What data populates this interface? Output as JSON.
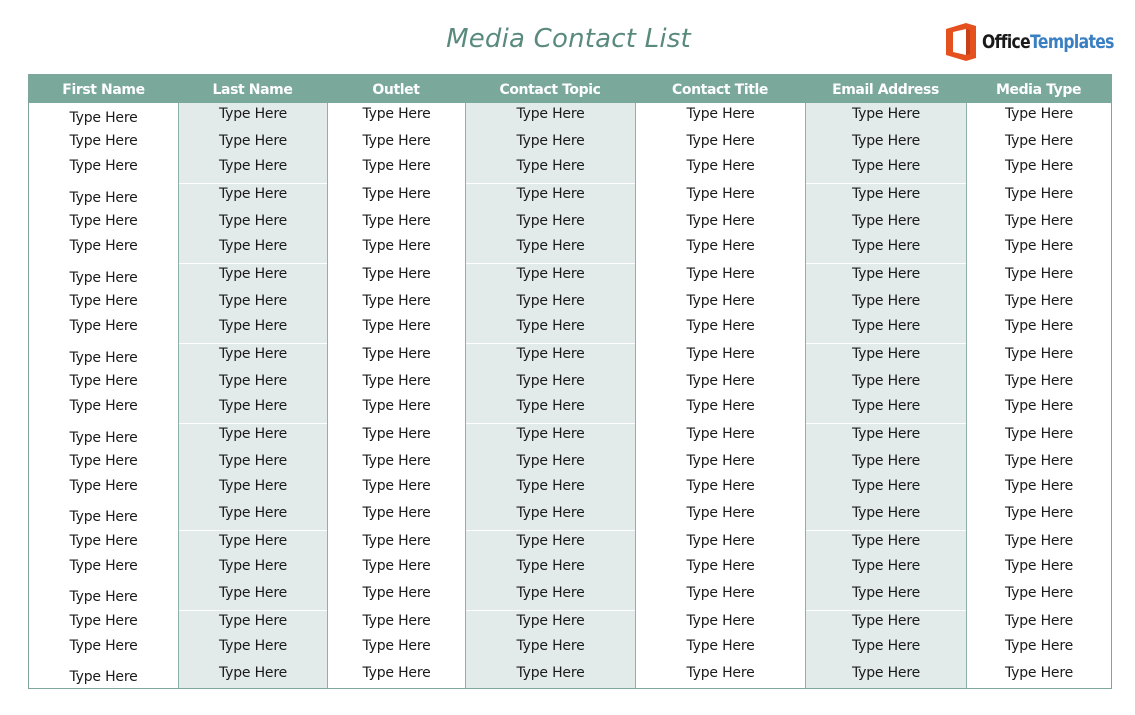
{
  "document": {
    "title": "Media Contact List",
    "logo": {
      "word1": "Office",
      "word2": "Templates",
      "icon": "office-logo-icon"
    },
    "colors": {
      "header_bg": "#7aa89b",
      "title": "#5a8a7e",
      "shaded_column": "#e2eaea",
      "border": "#7fa69c",
      "logo_orange": "#e4511e",
      "logo_blue": "#3a7fc2"
    }
  },
  "table": {
    "columns": [
      {
        "key": "first_name",
        "label": "First Name"
      },
      {
        "key": "last_name",
        "label": "Last Name"
      },
      {
        "key": "outlet",
        "label": "Outlet"
      },
      {
        "key": "contact_topic",
        "label": "Contact Topic"
      },
      {
        "key": "contact_title",
        "label": "Contact Title"
      },
      {
        "key": "email_address",
        "label": "Email Address"
      },
      {
        "key": "media_type",
        "label": "Media Type"
      }
    ],
    "placeholder": "Type Here",
    "row_count": 22,
    "rows": [
      [
        "Type Here",
        "Type Here",
        "Type Here",
        "Type Here",
        "Type Here",
        "Type Here",
        "Type Here"
      ],
      [
        "Type Here",
        "Type Here",
        "Type Here",
        "Type Here",
        "Type Here",
        "Type Here",
        "Type Here"
      ],
      [
        "Type Here",
        "Type Here",
        "Type Here",
        "Type Here",
        "Type Here",
        "Type Here",
        "Type Here"
      ],
      [
        "Type Here",
        "Type Here",
        "Type Here",
        "Type Here",
        "Type Here",
        "Type Here",
        "Type Here"
      ],
      [
        "Type Here",
        "Type Here",
        "Type Here",
        "Type Here",
        "Type Here",
        "Type Here",
        "Type Here"
      ],
      [
        "Type Here",
        "Type Here",
        "Type Here",
        "Type Here",
        "Type Here",
        "Type Here",
        "Type Here"
      ],
      [
        "Type Here",
        "Type Here",
        "Type Here",
        "Type Here",
        "Type Here",
        "Type Here",
        "Type Here"
      ],
      [
        "Type Here",
        "Type Here",
        "Type Here",
        "Type Here",
        "Type Here",
        "Type Here",
        "Type Here"
      ],
      [
        "Type Here",
        "Type Here",
        "Type Here",
        "Type Here",
        "Type Here",
        "Type Here",
        "Type Here"
      ],
      [
        "Type Here",
        "Type Here",
        "Type Here",
        "Type Here",
        "Type Here",
        "Type Here",
        "Type Here"
      ],
      [
        "Type Here",
        "Type Here",
        "Type Here",
        "Type Here",
        "Type Here",
        "Type Here",
        "Type Here"
      ],
      [
        "Type Here",
        "Type Here",
        "Type Here",
        "Type Here",
        "Type Here",
        "Type Here",
        "Type Here"
      ],
      [
        "Type Here",
        "Type Here",
        "Type Here",
        "Type Here",
        "Type Here",
        "Type Here",
        "Type Here"
      ],
      [
        "Type Here",
        "Type Here",
        "Type Here",
        "Type Here",
        "Type Here",
        "Type Here",
        "Type Here"
      ],
      [
        "Type Here",
        "Type Here",
        "Type Here",
        "Type Here",
        "Type Here",
        "Type Here",
        "Type Here"
      ],
      [
        "Type Here",
        "Type Here",
        "Type Here",
        "Type Here",
        "Type Here",
        "Type Here",
        "Type Here"
      ],
      [
        "Type Here",
        "Type Here",
        "Type Here",
        "Type Here",
        "Type Here",
        "Type Here",
        "Type Here"
      ],
      [
        "Type Here",
        "Type Here",
        "Type Here",
        "Type Here",
        "Type Here",
        "Type Here",
        "Type Here"
      ],
      [
        "Type Here",
        "Type Here",
        "Type Here",
        "Type Here",
        "Type Here",
        "Type Here",
        "Type Here"
      ],
      [
        "Type Here",
        "Type Here",
        "Type Here",
        "Type Here",
        "Type Here",
        "Type Here",
        "Type Here"
      ],
      [
        "Type Here",
        "Type Here",
        "Type Here",
        "Type Here",
        "Type Here",
        "Type Here",
        "Type Here"
      ],
      [
        "Type Here",
        "Type Here",
        "Type Here",
        "Type Here",
        "Type Here",
        "Type Here",
        "Type Here"
      ]
    ]
  }
}
